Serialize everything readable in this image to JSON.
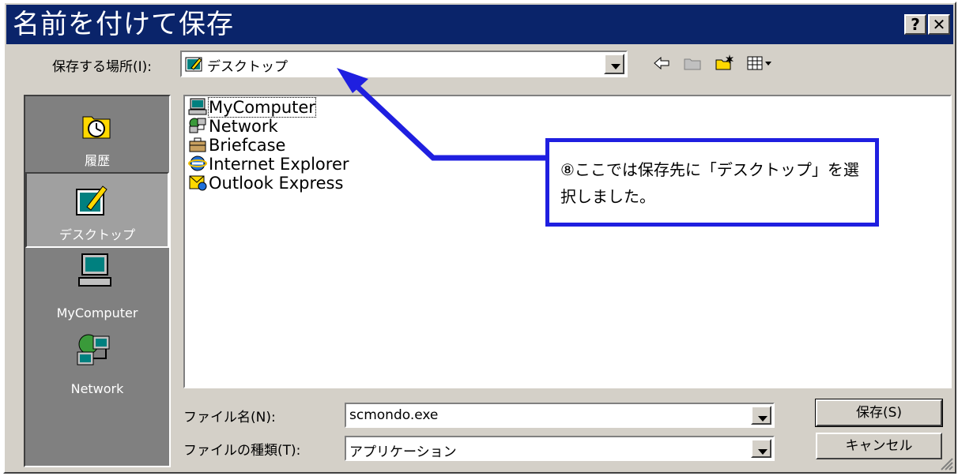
{
  "window": {
    "title": "名前を付けて保存",
    "help_label": "?",
    "close_label": "✕"
  },
  "location": {
    "label": "保存する場所(I):",
    "value": "デスクトップ"
  },
  "toolbar": {
    "icons": [
      "back-icon",
      "up-folder-icon",
      "new-folder-icon",
      "view-menu-icon"
    ]
  },
  "places": [
    {
      "label": "履歴",
      "icon": "history-icon"
    },
    {
      "label": "デスクトップ",
      "icon": "desktop-icon",
      "selected": true
    },
    {
      "label": "MyComputer",
      "icon": "computer-icon"
    },
    {
      "label": "Network",
      "icon": "network-icon"
    }
  ],
  "files": [
    {
      "name": "MyComputer",
      "icon": "computer-icon",
      "focused": true
    },
    {
      "name": "Network",
      "icon": "network-icon"
    },
    {
      "name": "Briefcase",
      "icon": "briefcase-icon"
    },
    {
      "name": "Internet Explorer",
      "icon": "ie-icon"
    },
    {
      "name": "Outlook Express",
      "icon": "outlook-icon"
    }
  ],
  "filename": {
    "label": "ファイル名(N):",
    "value": "scmondo.exe"
  },
  "filetype": {
    "label": "ファイルの種類(T):",
    "value": "アプリケーション"
  },
  "buttons": {
    "save": "保存(S)",
    "cancel": "キャンセル"
  },
  "annotation": {
    "text": "⑧ここでは保存先に「デスクトップ」を選択しました。",
    "color": "#1f1fe0"
  },
  "colors": {
    "titlebar": "#0a246a",
    "face": "#d4d0c8",
    "places_bg": "#808080",
    "arrow": "#1f1fe0"
  }
}
